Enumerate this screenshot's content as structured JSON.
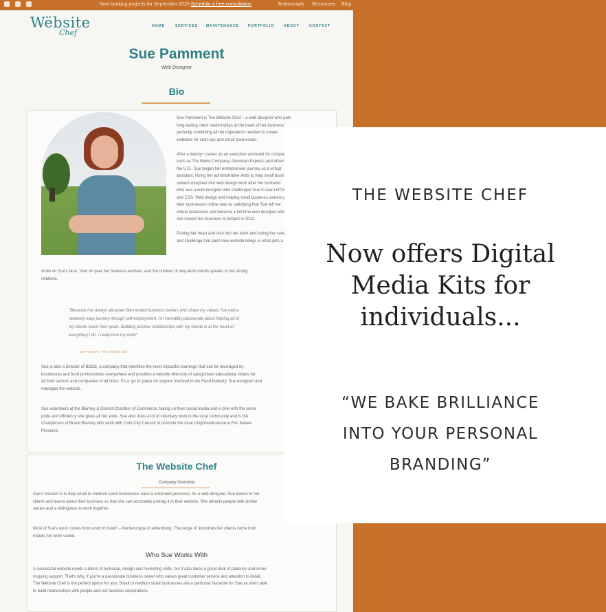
{
  "colors": {
    "accent": "#c7702a",
    "teal": "#2e8089",
    "gold": "#d7a25b"
  },
  "topbar": {
    "icons": [
      "facebook-icon",
      "instagram-icon",
      "linkedin-icon"
    ],
    "announcement": "Now booking projects for September 2025",
    "announcement_link": "Schedule a free consultation",
    "links": [
      "Testimonials",
      "Resources",
      "Blog"
    ]
  },
  "nav": {
    "logo": "Wëbsite",
    "logo_sub": "Chef",
    "items": [
      "HOME",
      "SERVICES",
      "MAINTENANCE",
      "PORTFOLIO",
      "ABOUT",
      "CONTACT"
    ]
  },
  "profile": {
    "name": "Sue Pamment",
    "role": "Web Designer",
    "bio_heading": "Bio"
  },
  "bio_right": [
    "Sue Pamment is The Website Chef – a web designer who puts",
    "long-lasting client relationships at the heart of her business,",
    "perfectly combining all the ingredients needed to create",
    "websites for start-ups and small businesses.",
    "",
    "After a twenty+ career as an executive assistant for companies",
    "such as The Baloo Company, American Express and others in",
    "the U.S., Sue began her entrepreneur journey as a virtual",
    "assistant. Using her administrative skills to help small business",
    "owners morphed into web design work after her husband",
    "who was a web designer who challenged Sue to learn HTML",
    "and CSS. Web design and helping small business owners get",
    "their businesses online was so satisfying that Sue left her",
    "virtual assistance and became a full-time web designer when",
    "she moved her business to Ireland in 2012.",
    "",
    "Putting her heart and soul into her work and loving the variety",
    "and challenge that each new website brings is what puts a"
  ],
  "bio_full": [
    "smile on Sue's face. Year on year her business evolves, and the number of long-term clients speaks to her strong",
    "relations."
  ],
  "quote": [
    "\"Because I've always attracted like-minded business owners who share my values, I've had a",
    "relatively easy journey through self-employment. I'm incredibly passionate about helping all of",
    "my clients reach their goals. Building positive relationships with my clients is at the heart of",
    "everything I do. I really love my work!\""
  ],
  "quote_cite": "Sue Pamment – The Website Chef",
  "para3": [
    "Sue is also a director of BizBiz, a company that identifies the most impactful learnings that can be leveraged by",
    "businesses and food professionals everywhere and provides a website directory of categorised educational videos for",
    "all food sectors and companies of all sizes. It's a 'go to' place for anyone involved in the Food Industry. Sue designed and",
    "manages the website."
  ],
  "para4": [
    "Sue volunteers at the Blarney & District Chamber of Commerce, taking on their social media and e-zine with the same",
    "pride and efficiency she gives all her work. Sue also does a lot of voluntary work in the local community and is the",
    "Chairperson of Brand Blarney who work with Cork City Council to promote the local Cloghroe/Inniscarra Fen Nature",
    "Preserve."
  ],
  "company": {
    "heading": "The Website Chef",
    "subheading": "Company Overview"
  },
  "para5": [
    "Sue's mission is to help small to medium sized businesses have a solid web presence. As a web designer, Sue listens to her",
    "clients and learns about their business so that she can accurately portray it in their website. She attracts people with similar",
    "values and a willingness to work together."
  ],
  "para6": [
    "Most of Sue's work comes from word of mouth – the best type of advertising. The range of industries her clients come from",
    "makes her work varied."
  ],
  "who_heading": "Who Sue Works With",
  "para7": [
    "A successful website needs a blend of technical, design and marketing skills, but it also takes a great deal of patience and some",
    "ongoing support. That's why, if you're a passionate business owner who values great customer service and attention to detail,",
    "The Website Chef is the perfect option for you. Small to medium sized businesses are a particular favourite for Sue as she's able",
    "to build relationships with people and not faceless corporations."
  ],
  "card": {
    "brand": "THE WEBSITE CHEF",
    "headline": [
      "Now offers Digital",
      "Media Kits for",
      "individuals..."
    ],
    "tagline": [
      "“WE BAKE BRILLIANCE",
      "INTO YOUR PERSONAL",
      "BRANDING”"
    ]
  }
}
